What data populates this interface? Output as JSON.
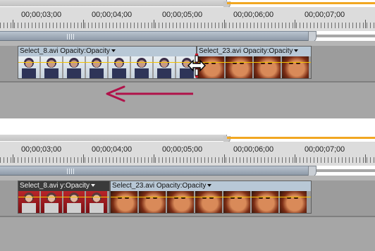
{
  "timeline_top": {
    "timecodes": [
      "00;00;03;00",
      "00;00;04;00",
      "00;00;05;00",
      "00;00;06;00",
      "00;00;07;00"
    ],
    "clip1": {
      "name": "Select_8.avi",
      "effect": "Opacity:Opacity"
    },
    "clip2": {
      "name": "Select_23.avi",
      "effect": "Opacity:Opacity"
    }
  },
  "timeline_bottom": {
    "timecodes": [
      "00;00;03;00",
      "00;00;04;00",
      "00;00;05;00",
      "00;00;06;00",
      "00;00;07;00"
    ],
    "clip1": {
      "name": "Select_8.avi",
      "effect": "y:Opacity"
    },
    "clip2": {
      "name": "Select_23.avi",
      "effect": "Opacity:Opacity"
    }
  },
  "icons": {
    "trim": "ripple-trim-cursor-icon",
    "direction": "drag-left-arrow-icon",
    "dropdown": "chevron-down-icon"
  },
  "colors": {
    "playhead_bar": "#f1a722",
    "clip_header": "#b8c8d6",
    "selected_clip_header": "#3a3a3a",
    "drag_arrow": "#b0124a"
  }
}
